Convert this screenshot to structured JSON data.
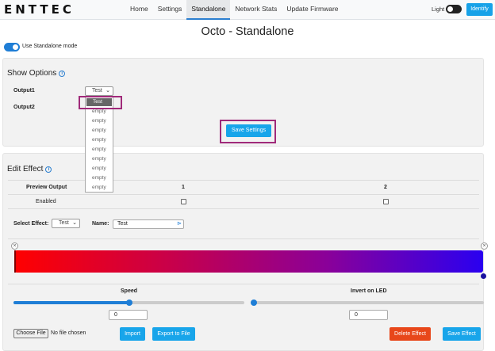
{
  "navbar": {
    "logo": "ENTTEC",
    "links": [
      "Home",
      "Settings",
      "Standalone",
      "Network Stats",
      "Update Firmware"
    ],
    "theme_label": "Light",
    "identify_label": "Identify"
  },
  "page": {
    "title": "Octo - Standalone",
    "standalone_mode_label": "Use Standalone mode",
    "standalone_mode_on": true
  },
  "show_options": {
    "title": "Show Options",
    "info_icon": "i",
    "output1_label": "Output1",
    "output1_value": "Test",
    "output2_label": "Output2",
    "dropdown_options": [
      "Test",
      "empty",
      "empty",
      "empty",
      "empty",
      "empty",
      "empty",
      "empty",
      "empty",
      "empty"
    ],
    "save_label": "Save Settings"
  },
  "edit_effect": {
    "title": "Edit Effect",
    "info_icon": "i",
    "preview_output_label": "Preview Output",
    "col1": "1",
    "col2": "2",
    "enabled_label": "Enabled",
    "select_effect_label": "Select Effect:",
    "select_effect_value": "Test",
    "name_label": "Name:",
    "name_value": "Test",
    "gradient_colors": [
      "#ff0000",
      "#c8004a",
      "#8a0099",
      "#2a00f0"
    ],
    "speed_label": "Speed",
    "speed_value": "0",
    "speed_slider": 0.5,
    "invert_label": "Invert on LED",
    "invert_value": "0",
    "invert_slider": 0.0,
    "choose_file_label": "Choose File",
    "no_file_label": "No file chosen",
    "import_label": "Import",
    "export_label": "Export to File",
    "delete_label": "Delete Effect",
    "save_label": "Save Effect"
  }
}
